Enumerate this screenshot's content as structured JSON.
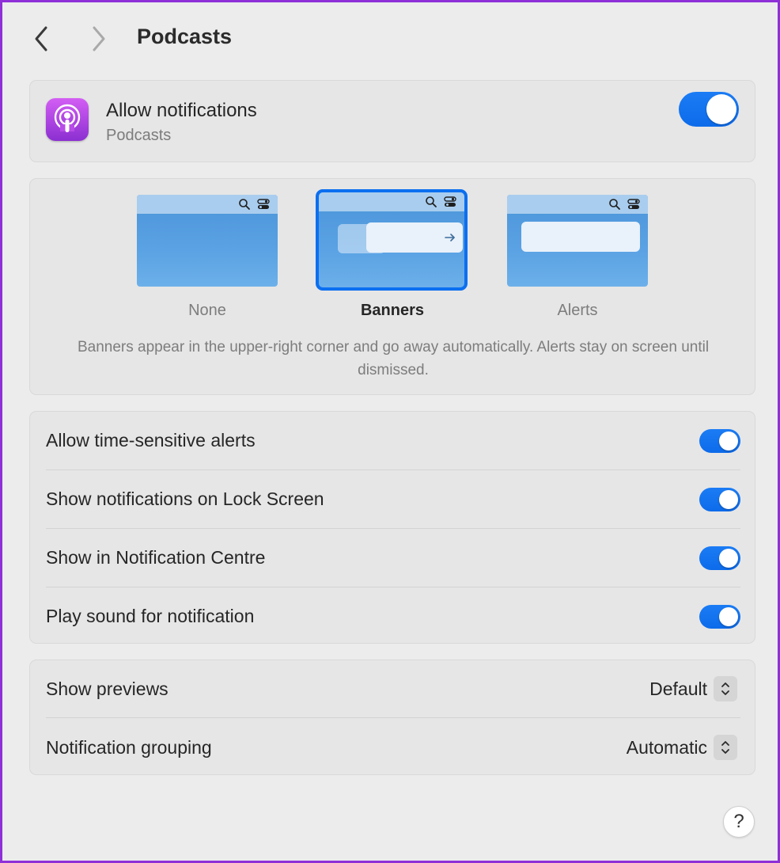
{
  "header": {
    "title": "Podcasts",
    "back_icon": "chevron-left-icon",
    "forward_icon": "chevron-right-icon"
  },
  "allow": {
    "title": "Allow notifications",
    "subtitle": "Podcasts",
    "enabled": true,
    "app_icon": "podcasts-icon"
  },
  "alert_style": {
    "options": [
      {
        "label": "None",
        "selected": false
      },
      {
        "label": "Banners",
        "selected": true
      },
      {
        "label": "Alerts",
        "selected": false
      }
    ],
    "description": "Banners appear in the upper-right corner and go away automatically. Alerts stay on screen until dismissed."
  },
  "toggles": [
    {
      "label": "Allow time-sensitive alerts",
      "enabled": true
    },
    {
      "label": "Show notifications on Lock Screen",
      "enabled": true
    },
    {
      "label": "Show in Notification Centre",
      "enabled": true
    },
    {
      "label": "Play sound for notification",
      "enabled": true
    }
  ],
  "selects": [
    {
      "label": "Show previews",
      "value": "Default"
    },
    {
      "label": "Notification grouping",
      "value": "Automatic"
    }
  ],
  "help": {
    "label": "?"
  },
  "colors": {
    "accent": "#0d6bea",
    "window_border": "#8e2fd8",
    "background": "#ececec"
  }
}
